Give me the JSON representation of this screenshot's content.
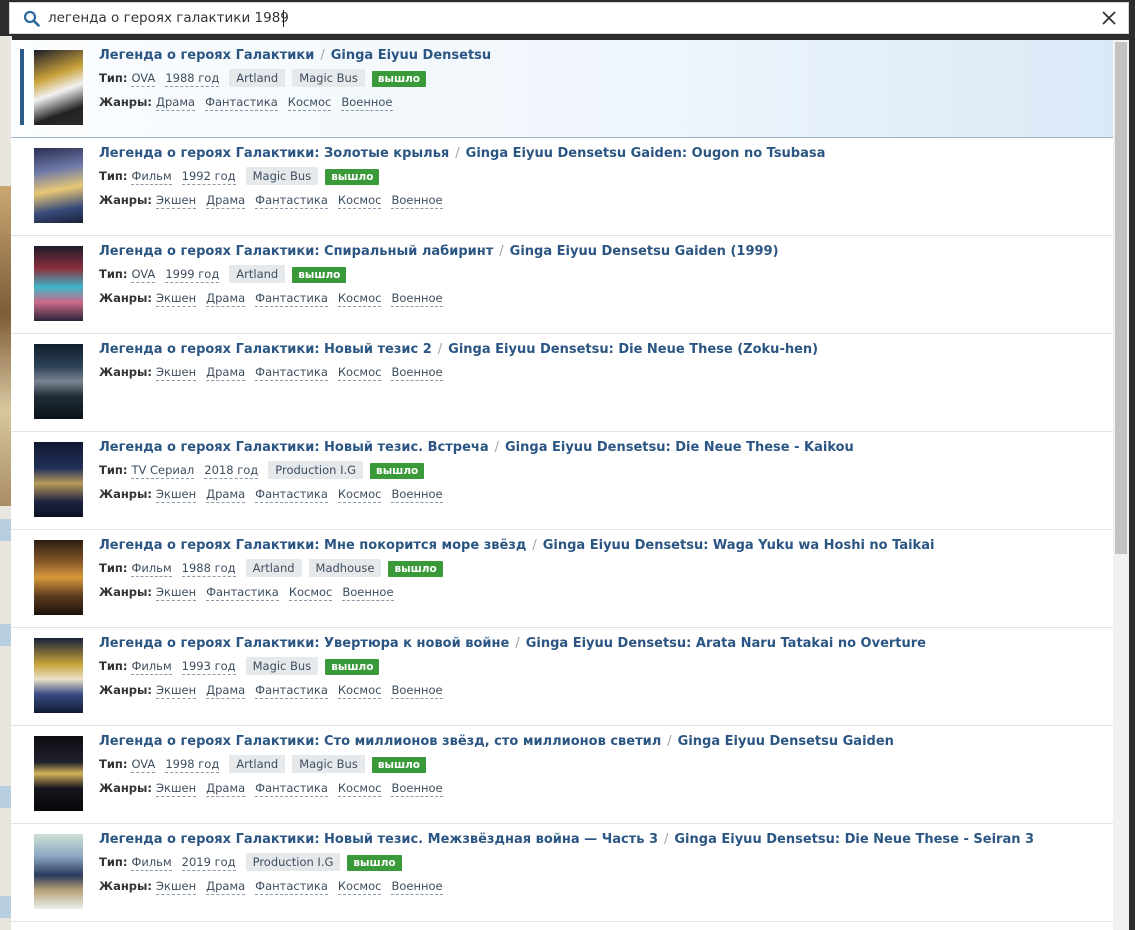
{
  "search": {
    "value": "легенда о героях галактики 1989",
    "placeholder": ""
  },
  "labels": {
    "type": "Тип:",
    "genres": "Жанры:"
  },
  "colors": {
    "title": "#2b5683",
    "badge": "#3a9a3a",
    "active_bar": "#2d5a86"
  },
  "icons": {
    "search": "search-icon",
    "clear": "close-icon"
  },
  "results": [
    {
      "title_ru": "Легенда о героях Галактики",
      "title_en": "Ginga Eiyuu Densetsu",
      "type": "OVA",
      "year": "1988 год",
      "studios": [
        "Artland",
        "Magic Bus"
      ],
      "status": "вышло",
      "genres": [
        "Драма",
        "Фантастика",
        "Космос",
        "Военное"
      ],
      "active": true
    },
    {
      "title_ru": "Легенда о героях Галактики: Золотые крылья",
      "title_en": "Ginga Eiyuu Densetsu Gaiden: Ougon no Tsubasa",
      "type": "Фильм",
      "year": "1992 год",
      "studios": [
        "Magic Bus"
      ],
      "status": "вышло",
      "genres": [
        "Экшен",
        "Драма",
        "Фантастика",
        "Космос",
        "Военное"
      ]
    },
    {
      "title_ru": "Легенда о героях Галактики: Спиральный лабиринт",
      "title_en": "Ginga Eiyuu Densetsu Gaiden (1999)",
      "type": "OVA",
      "year": "1999 год",
      "studios": [
        "Artland"
      ],
      "status": "вышло",
      "genres": [
        "Экшен",
        "Драма",
        "Фантастика",
        "Космос",
        "Военное"
      ]
    },
    {
      "title_ru": "Легенда о героях Галактики: Новый тезис 2",
      "title_en": "Ginga Eiyuu Densetsu: Die Neue These (Zoku-hen)",
      "type": null,
      "year": null,
      "studios": [],
      "status": null,
      "genres": [
        "Экшен",
        "Драма",
        "Фантастика",
        "Космос",
        "Военное"
      ]
    },
    {
      "title_ru": "Легенда о героях Галактики: Новый тезис. Встреча",
      "title_en": "Ginga Eiyuu Densetsu: Die Neue These - Kaikou",
      "type": "TV Сериал",
      "year": "2018 год",
      "studios": [
        "Production I.G"
      ],
      "status": "вышло",
      "genres": [
        "Экшен",
        "Драма",
        "Фантастика",
        "Космос",
        "Военное"
      ]
    },
    {
      "title_ru": "Легенда о героях Галактики: Мне покорится море звёзд",
      "title_en": "Ginga Eiyuu Densetsu: Waga Yuku wa Hoshi no Taikai",
      "type": "Фильм",
      "year": "1988 год",
      "studios": [
        "Artland",
        "Madhouse"
      ],
      "status": "вышло",
      "genres": [
        "Экшен",
        "Фантастика",
        "Космос",
        "Военное"
      ]
    },
    {
      "title_ru": "Легенда о героях Галактики: Увертюра к новой войне",
      "title_en": "Ginga Eiyuu Densetsu: Arata Naru Tatakai no Overture",
      "type": "Фильм",
      "year": "1993 год",
      "studios": [
        "Magic Bus"
      ],
      "status": "вышло",
      "genres": [
        "Экшен",
        "Драма",
        "Фантастика",
        "Космос",
        "Военное"
      ]
    },
    {
      "title_ru": "Легенда о героях Галактики: Сто миллионов звёзд, сто миллионов светил",
      "title_en": "Ginga Eiyuu Densetsu Gaiden",
      "type": "OVA",
      "year": "1998 год",
      "studios": [
        "Artland",
        "Magic Bus"
      ],
      "status": "вышло",
      "genres": [
        "Экшен",
        "Драма",
        "Фантастика",
        "Космос",
        "Военное"
      ]
    },
    {
      "title_ru": "Легенда о героях Галактики: Новый тезис. Межзвёздная война — Часть 3",
      "title_en": "Ginga Eiyuu Densetsu: Die Neue These - Seiran 3",
      "type": "Фильм",
      "year": "2019 год",
      "studios": [
        "Production I.G"
      ],
      "status": "вышло",
      "genres": [
        "Экшен",
        "Драма",
        "Фантастика",
        "Космос",
        "Военное"
      ]
    }
  ]
}
